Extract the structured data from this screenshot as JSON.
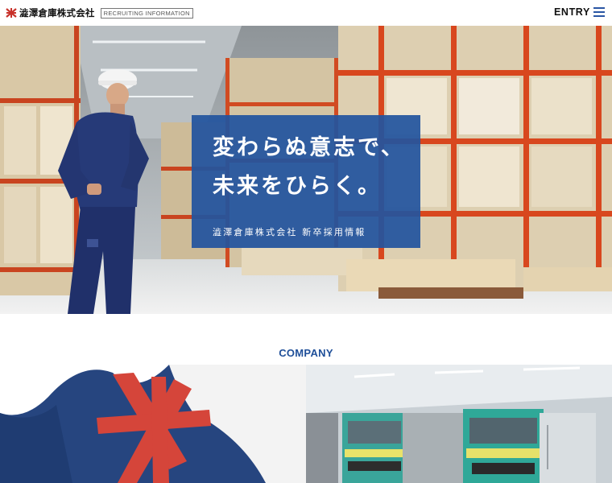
{
  "header": {
    "logo_text": "澁澤倉庫株式会社",
    "recruit_tag": "RECRUITING INFORMATION",
    "entry_label": "ENTRY",
    "menu_icon": "hamburger-menu-icon"
  },
  "hero": {
    "headline_line1": "変わらぬ意志で、",
    "headline_line2": "未来をひらく。",
    "subline": "澁澤倉庫株式会社 新卒採用情報",
    "panel_color": "#22549e"
  },
  "company": {
    "section_title": "COMPANY"
  },
  "colors": {
    "accent_blue": "#2a56a4",
    "title_blue": "#1f4f99",
    "logo_red": "#c8322b"
  }
}
